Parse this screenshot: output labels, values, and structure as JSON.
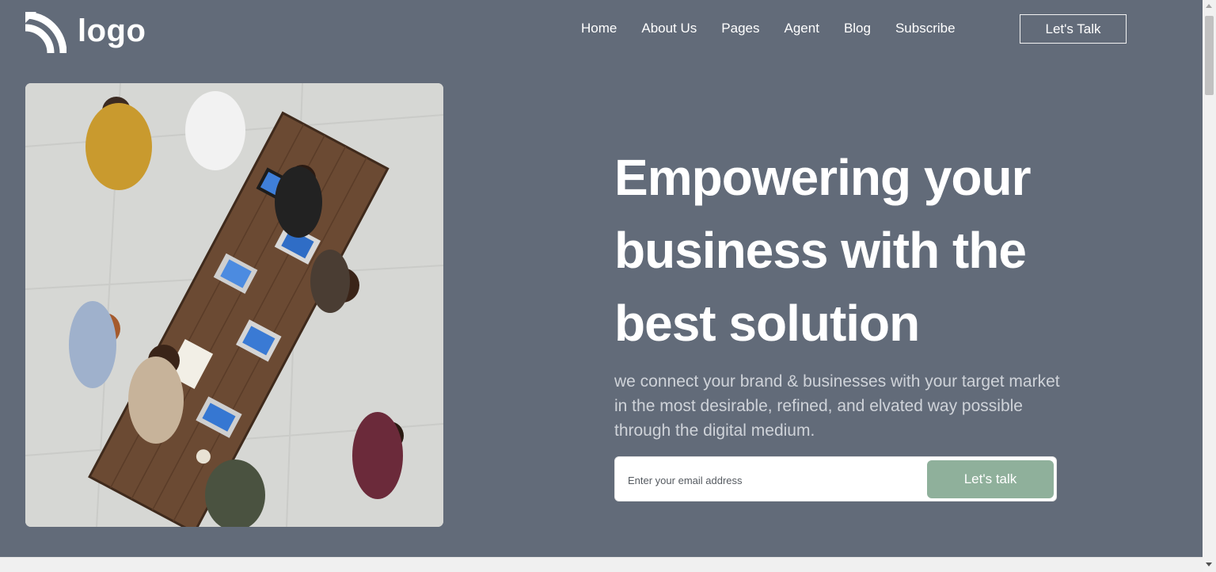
{
  "header": {
    "logo_text": "logo",
    "nav": [
      {
        "label": "Home"
      },
      {
        "label": "About Us"
      },
      {
        "label": "Pages"
      },
      {
        "label": "Agent"
      },
      {
        "label": "Blog"
      },
      {
        "label": "Subscribe"
      }
    ],
    "cta_label": "Let's Talk"
  },
  "hero": {
    "image_icon": "team-meeting-photo",
    "title_line1": "Empowering your",
    "title_line2": "business with the",
    "title_line3": "best solution",
    "subtitle": "we connect your brand & businesses with your target market in the most desirable, refined, and elvated way possible through the digital medium.",
    "email_placeholder": "Enter your email address",
    "email_value": "",
    "submit_label": "Let's talk"
  },
  "colors": {
    "background": "#626b79",
    "accent_button": "#8fb09b",
    "text": "#ffffff",
    "subtitle_text": "#cfd3d9"
  }
}
